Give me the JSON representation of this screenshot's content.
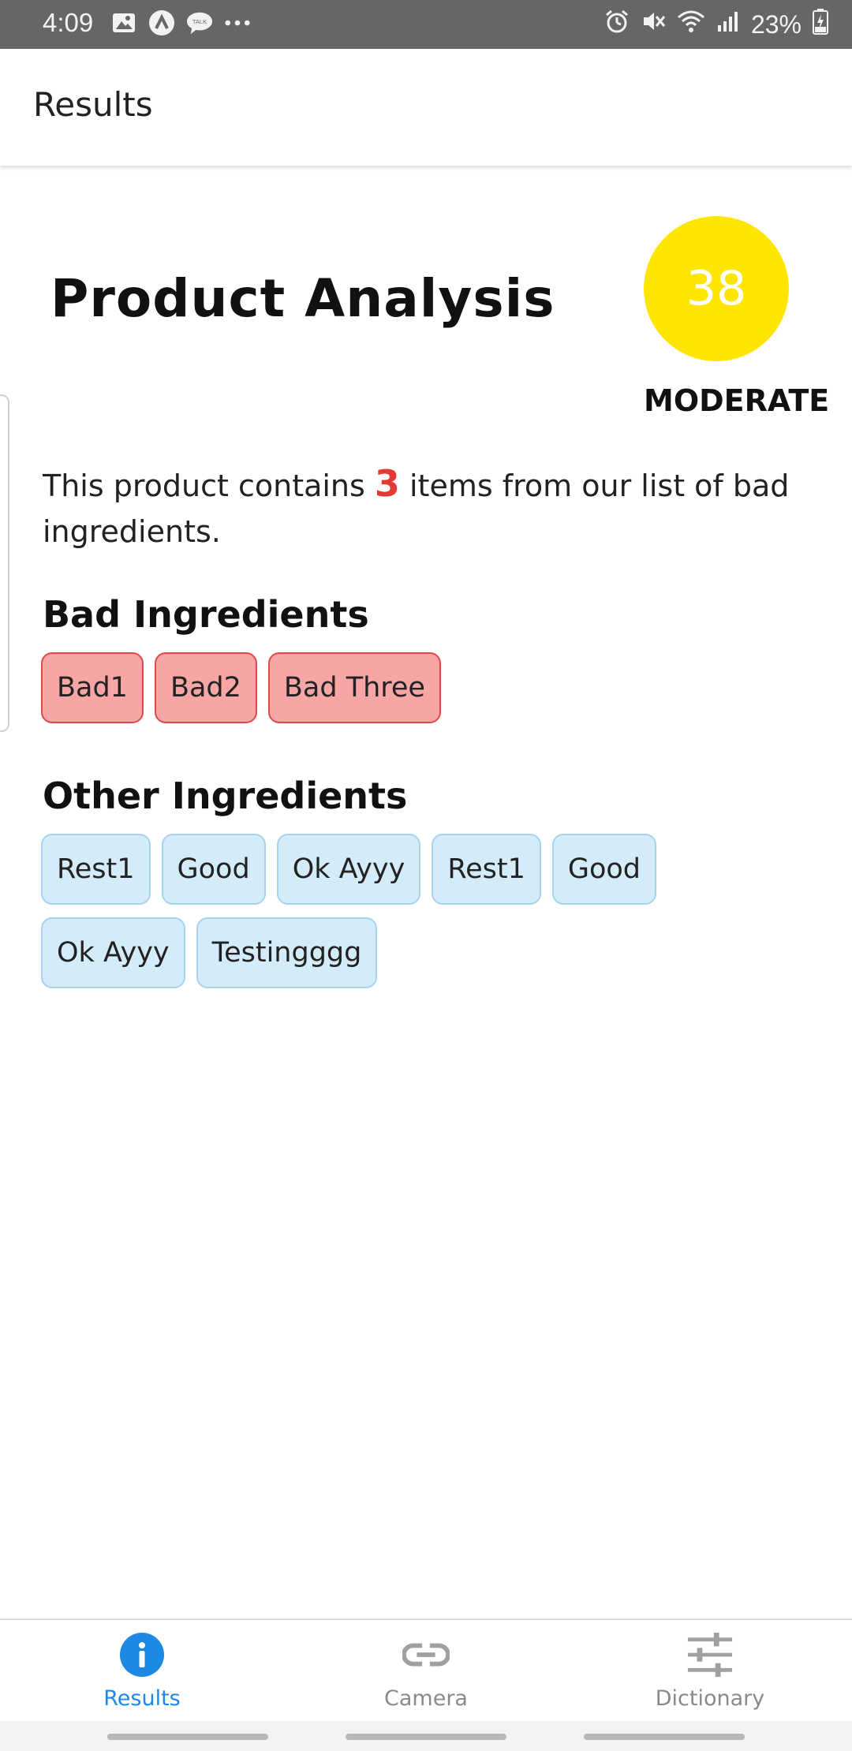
{
  "status_bar": {
    "time": "4:09",
    "battery": "23%",
    "left_icons": [
      "image-icon",
      "app-a-icon",
      "talk-icon",
      "more-dots-icon"
    ],
    "right_icons": [
      "alarm-icon",
      "mute-icon",
      "wifi-icon",
      "signal-icon",
      "battery-icon"
    ]
  },
  "app_bar": {
    "title": "Results"
  },
  "analysis": {
    "title": "Product Analysis",
    "score": "38",
    "rating": "MODERATE",
    "score_color": "#FFE600",
    "summary_prefix": "This product contains ",
    "bad_count": "3",
    "summary_suffix": " items from our list of bad ingredients."
  },
  "bad_ingredients": {
    "title": "Bad Ingredients",
    "items": [
      "Bad1",
      "Bad2",
      "Bad Three"
    ]
  },
  "other_ingredients": {
    "title": "Other Ingredients",
    "items": [
      "Rest1",
      "Good",
      "Ok Ayyy",
      "Rest1",
      "Good",
      "Ok Ayyy",
      "Testingggg"
    ]
  },
  "bottom_nav": {
    "items": [
      {
        "label": "Results",
        "icon": "info-icon",
        "active": true
      },
      {
        "label": "Camera",
        "icon": "link-icon",
        "active": false
      },
      {
        "label": "Dictionary",
        "icon": "sliders-icon",
        "active": false
      }
    ],
    "active_color": "#1E88E5"
  }
}
